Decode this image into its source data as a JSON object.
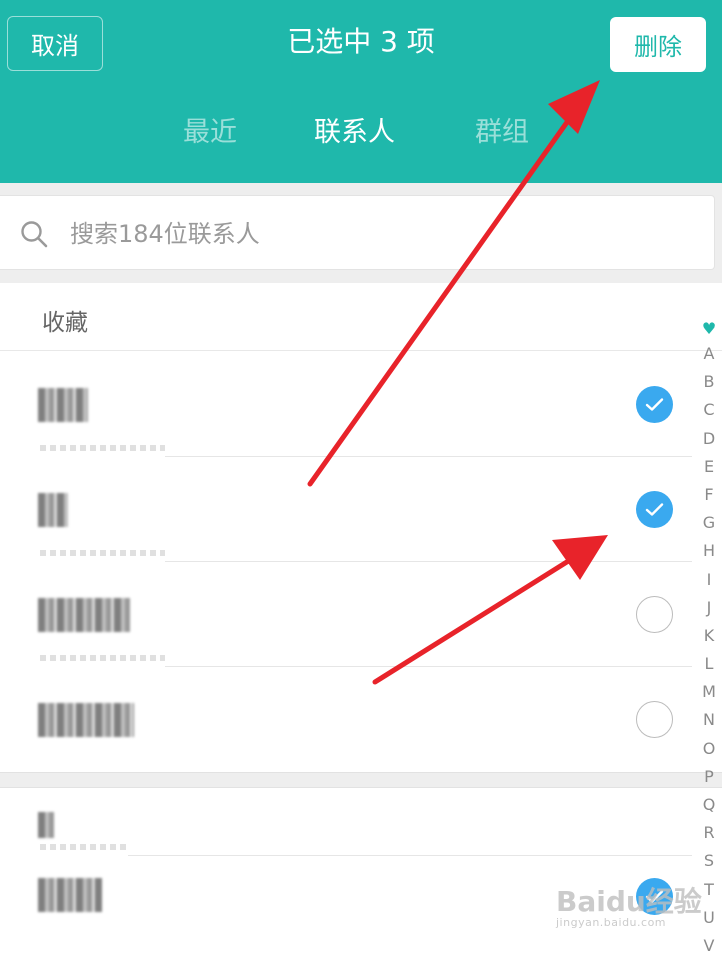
{
  "header": {
    "cancel_label": "取消",
    "title": "已选中  3  项",
    "delete_label": "删除",
    "tabs": [
      {
        "label": "最近",
        "active": false
      },
      {
        "label": "联系人",
        "active": true
      },
      {
        "label": "群组",
        "active": false
      }
    ]
  },
  "search": {
    "placeholder": "搜索184位联系人"
  },
  "list": {
    "section_title": "收藏",
    "contacts": [
      {
        "selected": true
      },
      {
        "selected": true
      },
      {
        "selected": false
      },
      {
        "selected": false
      },
      {
        "selected": false
      },
      {
        "selected": true
      }
    ]
  },
  "index_bar": {
    "favorite_icon": "heart-icon",
    "letters": [
      "A",
      "B",
      "C",
      "D",
      "E",
      "F",
      "G",
      "H",
      "I",
      "J",
      "K",
      "L",
      "M",
      "N",
      "O",
      "P",
      "Q",
      "R",
      "S",
      "T",
      "U",
      "V"
    ]
  },
  "watermark": {
    "text": "Baidu经验",
    "url_text": "jingyan.baidu.com"
  },
  "colors": {
    "accent": "#1fb8ab",
    "check": "#3aa9ef",
    "arrow": "#e8232a"
  }
}
